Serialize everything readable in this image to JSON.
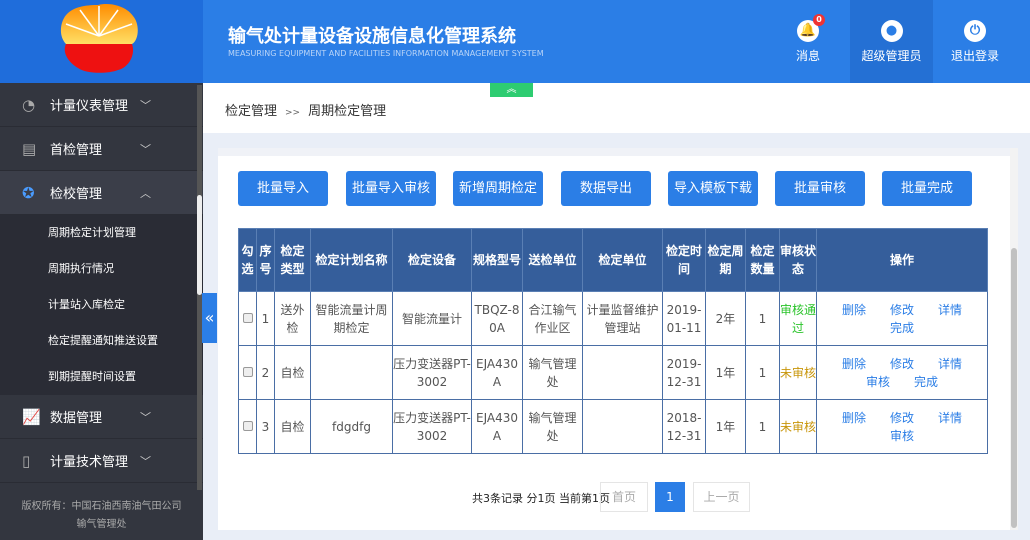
{
  "header": {
    "title": "输气处计量设备设施信息化管理系统",
    "subtitle": "MEASURING EQUIPMENT AND FACILITIES INFORMATION MANAGEMENT SYSTEM",
    "messages": "消息",
    "message_count": "0",
    "user": "超级管理员",
    "logout": "退出登录"
  },
  "sidebar": {
    "items": [
      {
        "label": "计量仪表管理"
      },
      {
        "label": "首检管理"
      },
      {
        "label": "检校管理"
      },
      {
        "label": "数据管理"
      },
      {
        "label": "计量技术管理"
      }
    ],
    "subitems": [
      "周期检定计划管理",
      "周期执行情况",
      "计量站入库检定",
      "检定提醒通知推送设置",
      "到期提醒时间设置"
    ],
    "footer1": "版权所有：中国石油西南油气田公司",
    "footer2": "输气管理处"
  },
  "breadcrumb": {
    "parent": "检定管理",
    "sep": ">>",
    "current": "周期检定管理"
  },
  "toolbar": [
    "批量导入",
    "批量导入审核",
    "新增周期检定",
    "数据导出",
    "导入模板下载",
    "批量审核",
    "批量完成"
  ],
  "table": {
    "headers": [
      "勾选",
      "序号",
      "检定类型",
      "检定计划名称",
      "检定设备",
      "规格型号",
      "送检单位",
      "检定单位",
      "检定时间",
      "检定周期",
      "检定数量",
      "审核状态",
      "操作"
    ],
    "rows": [
      {
        "no": "1",
        "type": "送外检",
        "name": "智能流量计周期检定",
        "device": "智能流量计",
        "model": "TBQZ-80A",
        "sender": "合江输气作业区",
        "unit": "计量监督维护管理站",
        "date": "2019-01-11",
        "period": "2年",
        "qty": "1",
        "status": "审核通过",
        "ops": [
          "删除",
          "修改",
          "详情",
          "完成"
        ]
      },
      {
        "no": "2",
        "type": "自检",
        "name": "",
        "device": "压力变送器PT-3002",
        "model": "EJA430A",
        "sender": "输气管理处",
        "unit": "",
        "date": "2019-12-31",
        "period": "1年",
        "qty": "1",
        "status": "未审核",
        "ops": [
          "删除",
          "修改",
          "详情",
          "审核",
          "完成"
        ]
      },
      {
        "no": "3",
        "type": "自检",
        "name": "fdgdfg",
        "device": "压力变送器PT-3002",
        "model": "EJA430A",
        "sender": "输气管理处",
        "unit": "",
        "date": "2018-12-31",
        "period": "1年",
        "qty": "1",
        "status": "未审核",
        "ops": [
          "删除",
          "修改",
          "详情",
          "审核"
        ]
      }
    ]
  },
  "pagination": {
    "info": "共3条记录 分1页 当前第1页",
    "first": "首页",
    "current": "1",
    "prev": "上一页"
  }
}
